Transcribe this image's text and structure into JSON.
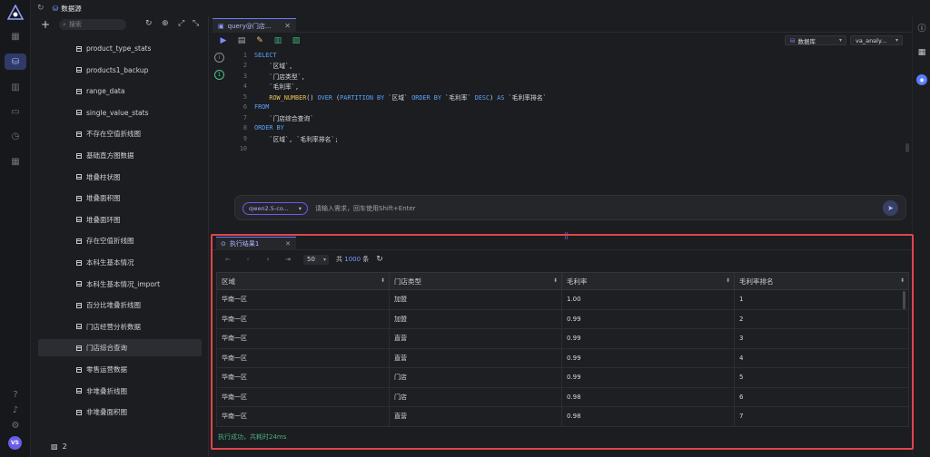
{
  "header": {
    "title": "数据源"
  },
  "tree": {
    "search_placeholder": "搜索",
    "items": [
      {
        "label": "product_type_stats",
        "selected": false
      },
      {
        "label": "products1_backup",
        "selected": false
      },
      {
        "label": "range_data",
        "selected": false
      },
      {
        "label": "single_value_stats",
        "selected": false
      },
      {
        "label": "不存在空值折线图",
        "selected": false
      },
      {
        "label": "基础直方图数据",
        "selected": false
      },
      {
        "label": "堆叠柱状图",
        "selected": false
      },
      {
        "label": "堆叠面积图",
        "selected": false
      },
      {
        "label": "堆叠面环图",
        "selected": false
      },
      {
        "label": "存在空值折线图",
        "selected": false
      },
      {
        "label": "本科生基本情况",
        "selected": false
      },
      {
        "label": "本科生基本情况_import",
        "selected": false
      },
      {
        "label": "百分比堆叠折线图",
        "selected": false
      },
      {
        "label": "门店经营分析数据",
        "selected": false
      },
      {
        "label": "门店综合查询",
        "selected": true
      },
      {
        "label": "零售运营数据",
        "selected": false
      },
      {
        "label": "非堆叠折线图",
        "selected": false
      },
      {
        "label": "非堆叠面积图",
        "selected": false
      }
    ],
    "footer_label": "2"
  },
  "editor": {
    "tab_label": "query@门店...",
    "datasource_label": "数据库",
    "schema_label": "va_analy...",
    "lines": [
      [
        {
          "t": "SELECT",
          "c": "kw"
        }
      ],
      [
        {
          "t": "    `区域`,",
          "c": "str"
        }
      ],
      [
        {
          "t": "    `门店类型`,",
          "c": "str"
        }
      ],
      [
        {
          "t": "    `毛利率`,",
          "c": "str"
        }
      ],
      [
        {
          "t": "    ",
          "c": "str"
        },
        {
          "t": "ROW_NUMBER",
          "c": "fn"
        },
        {
          "t": "() ",
          "c": "str"
        },
        {
          "t": "OVER",
          "c": "kw"
        },
        {
          "t": " (",
          "c": "str"
        },
        {
          "t": "PARTITION BY",
          "c": "kw"
        },
        {
          "t": " `区域` ",
          "c": "str"
        },
        {
          "t": "ORDER BY",
          "c": "kw"
        },
        {
          "t": " `毛利率` ",
          "c": "str"
        },
        {
          "t": "DESC",
          "c": "kw"
        },
        {
          "t": ") ",
          "c": "str"
        },
        {
          "t": "AS",
          "c": "kw"
        },
        {
          "t": " `毛利率排名`",
          "c": "str"
        }
      ],
      [
        {
          "t": "FROM",
          "c": "kw"
        }
      ],
      [
        {
          "t": "    `门店综合查询`",
          "c": "str"
        }
      ],
      [
        {
          "t": "ORDER BY",
          "c": "kw"
        }
      ],
      [
        {
          "t": "    `区域`, `毛利率排名`;",
          "c": "str"
        }
      ],
      [
        {
          "t": "",
          "c": "str"
        }
      ]
    ]
  },
  "ai": {
    "model_label": "qwen2.5-co...",
    "placeholder": "请输入需求，回车使用Shift+Enter"
  },
  "results": {
    "tab_label": "执行结果1",
    "page_size": "50",
    "total_prefix": "共",
    "total_count": "1000",
    "total_suffix": "条",
    "columns": [
      "区域",
      "门店类型",
      "毛利率",
      "毛利率排名"
    ],
    "rows": [
      [
        "华南一区",
        "加盟",
        "1.00",
        "1"
      ],
      [
        "华南一区",
        "加盟",
        "0.99",
        "2"
      ],
      [
        "华南一区",
        "直营",
        "0.99",
        "3"
      ],
      [
        "华南一区",
        "直营",
        "0.99",
        "4"
      ],
      [
        "华南一区",
        "门店",
        "0.99",
        "5"
      ],
      [
        "华南一区",
        "门店",
        "0.98",
        "6"
      ],
      [
        "华南一区",
        "直营",
        "0.98",
        "7"
      ]
    ],
    "status": "执行成功，共耗时24ms"
  },
  "user": {
    "avatar_text": "VS"
  },
  "colors": {
    "accent": "#6b7cff",
    "highlight": "#e0454a",
    "success": "#48b07f"
  }
}
